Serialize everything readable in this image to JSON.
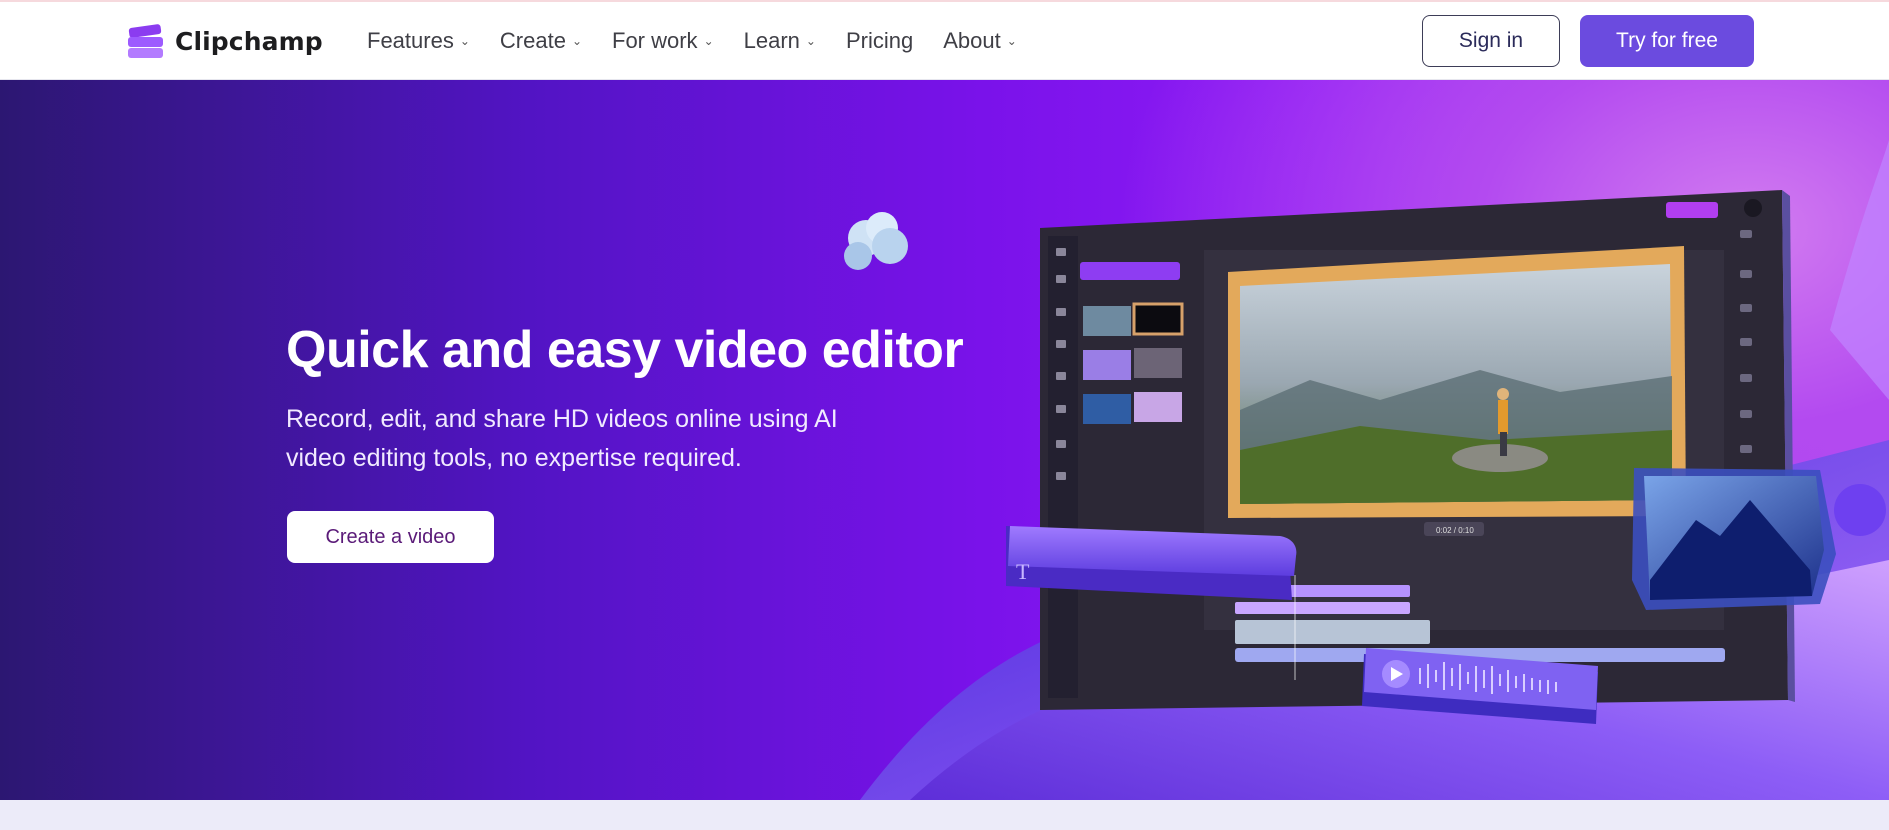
{
  "brand": {
    "name": "Clipchamp",
    "accent": "#6b4bdf"
  },
  "nav": {
    "items": [
      {
        "label": "Features",
        "has_dropdown": true
      },
      {
        "label": "Create",
        "has_dropdown": true
      },
      {
        "label": "For work",
        "has_dropdown": true
      },
      {
        "label": "Learn",
        "has_dropdown": true
      },
      {
        "label": "Pricing",
        "has_dropdown": false
      },
      {
        "label": "About",
        "has_dropdown": true
      }
    ],
    "sign_in": "Sign in",
    "try_free": "Try for free"
  },
  "hero": {
    "title": "Quick and easy video editor",
    "subtitle": "Record, edit, and share HD videos online using AI video editing tools, no expertise required.",
    "cta": "Create a video"
  },
  "illustration": {
    "playback_time": "0:02 / 0:10",
    "text_tile_glyph": "T"
  }
}
